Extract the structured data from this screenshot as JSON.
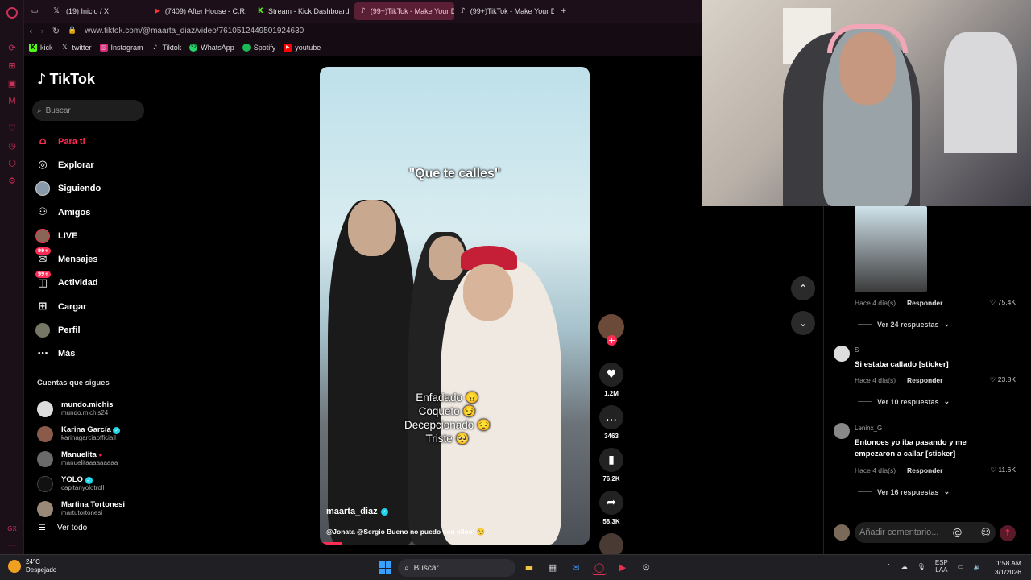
{
  "browser": {
    "tabs": [
      {
        "label": "(19) Inicio / X",
        "icon": "x-icon",
        "active": false
      },
      {
        "label": "(7409) After House - C.R.",
        "icon": "red-icon",
        "active": false
      },
      {
        "label": "Stream - Kick Dashboard",
        "icon": "kick-icon",
        "active": false
      },
      {
        "label": "(99+)TikTok - Make Your D",
        "icon": "tiktok-icon",
        "active": true
      },
      {
        "label": "(99+)TikTok - Make Your D",
        "icon": "tiktok-icon",
        "active": false
      }
    ],
    "url": "www.tiktok.com/@maarta_diaz/video/7610512449501924630",
    "bookmarks": [
      "kick",
      "twitter",
      "Instagram",
      "Tiktok",
      "WhatsApp",
      "Spotify",
      "youtube"
    ],
    "whatsapp_badge": "32"
  },
  "sidebar": {
    "logo": "TikTok",
    "search_placeholder": "Buscar",
    "menu": [
      {
        "label": "Para ti",
        "icon": "home-icon",
        "active": true
      },
      {
        "label": "Explorar",
        "icon": "compass-icon"
      },
      {
        "label": "Siguiendo",
        "icon": "following-avatar-icon"
      },
      {
        "label": "Amigos",
        "icon": "friends-icon"
      },
      {
        "label": "LIVE",
        "icon": "live-icon"
      },
      {
        "label": "Mensajes",
        "icon": "messages-icon",
        "badge": "99+"
      },
      {
        "label": "Actividad",
        "icon": "activity-icon",
        "badge": "99+"
      },
      {
        "label": "Cargar",
        "icon": "upload-icon"
      },
      {
        "label": "Perfil",
        "icon": "profile-avatar-icon"
      },
      {
        "label": "Más",
        "icon": "more-icon"
      }
    ],
    "following_header": "Cuentas que sigues",
    "following": [
      {
        "name": "mundo.michis",
        "user": "mundo.michis24"
      },
      {
        "name": "Karina García",
        "user": "karinagarciaofficiall",
        "verified": true
      },
      {
        "name": "Manuelita",
        "user": "manuelitaaaaaaaaa"
      },
      {
        "name": "YOLO",
        "user": "capitanyolotroll",
        "verified": true
      },
      {
        "name": "Martina Tortonesi",
        "user": "martutortonesi"
      }
    ],
    "see_all": "Ver todo"
  },
  "video": {
    "overlay_top": "\"Que te calles\"",
    "moods": [
      "Enfadado 😠",
      "Coqueto 😏",
      "Decepcionado 😔",
      "Triste 🥺"
    ],
    "author": "maarta_diaz",
    "description": "@Jonata @Sergio Bueno no puedo con ellos! 🥺",
    "progress": 0.08
  },
  "actions": {
    "likes": "1.2M",
    "comments": "3463",
    "saves": "76.2K",
    "shares": "58.3K"
  },
  "comments": [
    {
      "meta": "Hace 4 día(s)",
      "reply": "Responder",
      "likes": "75.4K",
      "more": "Ver 24 respuestas"
    },
    {
      "user": "S",
      "text": "Si estaba callado [sticker]",
      "meta": "Hace 4 día(s)",
      "reply": "Responder",
      "likes": "23.8K",
      "more": "Ver 10 respuestas"
    },
    {
      "user": "Leninx_G",
      "text": "Entonces yo iba pasando y me empezaron a callar [sticker]",
      "meta": "Hace 4 día(s)",
      "reply": "Responder",
      "likes": "11.6K",
      "more": "Ver 16 respuestas"
    }
  ],
  "comment_input_placeholder": "Añadir comentario...",
  "taskbar": {
    "temp": "24°C",
    "weather": "Despejado",
    "search": "Buscar",
    "lang": "ESP",
    "lang2": "LAA",
    "time": "1:58 AM",
    "date": "3/1/2026"
  },
  "colors": {
    "accent": "#fe2c55",
    "opera_bg": "#1c0f19",
    "active_tab": "#5a1f35"
  }
}
